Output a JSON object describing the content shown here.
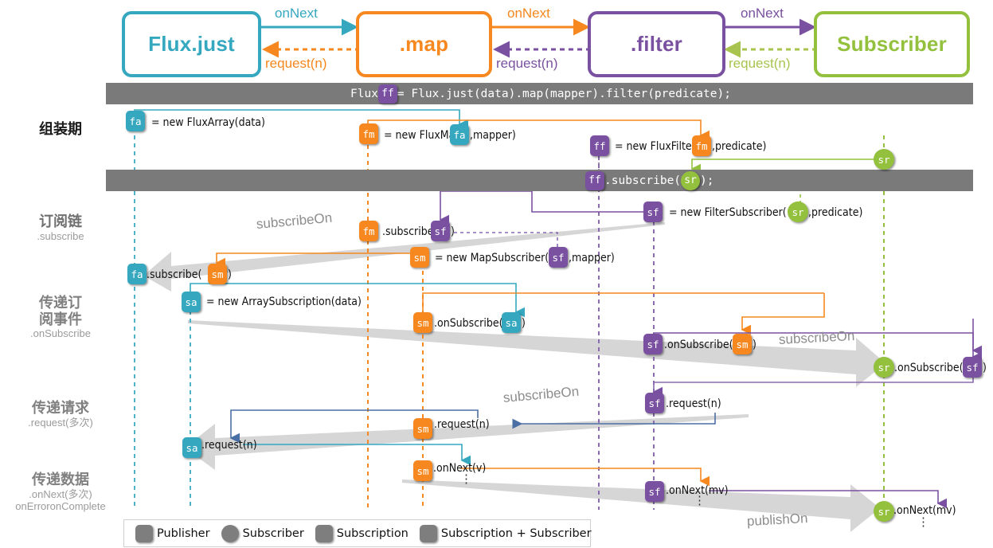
{
  "pipeline": {
    "boxes": [
      {
        "label": "Flux.just",
        "color": "#35a8c0"
      },
      {
        "label": ".map",
        "color": "#f6881f"
      },
      {
        "label": ".filter",
        "color": "#7a51a1"
      },
      {
        "label": "Subscriber",
        "color": "#93c13d"
      }
    ],
    "arrows": [
      {
        "forward": "onNext",
        "back": "request(n)",
        "forward_color": "#35a8c0",
        "back_color": "#f6881f"
      },
      {
        "forward": "onNext",
        "back": "request(n)",
        "forward_color": "#f6881f",
        "back_color": "#7a51a1"
      },
      {
        "forward": "onNext",
        "back": "request(n)",
        "forward_color": "#7a51a1",
        "back_color": "#a8c44e"
      }
    ]
  },
  "codebars": [
    {
      "pre": "Flux ",
      "token": "ff",
      "post": " = Flux.just(data).map(mapper).filter(predicate);"
    },
    {
      "pre": "",
      "token": "ff",
      "post": ".subscribe(",
      "token2": "sr",
      "post2": ");"
    }
  ],
  "rows": [
    {
      "cn": "组装期",
      "en": ""
    },
    {
      "cn": "订阅链",
      "en": ".subscribe"
    },
    {
      "cn": "传递订\n阅事件",
      "en": ".onSubscribe"
    },
    {
      "cn": "传递请求",
      "en": ".request(多次)"
    },
    {
      "cn": "传递数据",
      "en": ".onNext(多次)\nonError|onComplete"
    }
  ],
  "row_labels": {
    "assembly": "组装期",
    "subscribe_chain_cn": "订阅链",
    "subscribe_chain_en": ".subscribe",
    "onsubscribe_cn_1": "传递订",
    "onsubscribe_cn_2": "阅事件",
    "onsubscribe_en": ".onSubscribe",
    "request_cn": "传递请求",
    "request_en": ".request(多次)",
    "data_cn": "传递数据",
    "data_en_1": ".onNext(多次)",
    "data_en_2": "onErroronComplete"
  },
  "statements": {
    "fa_new": "= new FluxArray(data)",
    "fm_new_a": "= new FluxMap(",
    "fm_new_b": ",mapper)",
    "ff_new_a": "= new FluxFilter(",
    "ff_new_b": ",predicate)",
    "fm_subscribe_a": ".subscribe(",
    "fm_subscribe_b": ")",
    "sf_new_a": "= new FilterSubscriber(",
    "sf_new_b": ",predicate)",
    "sm_new_a": "= new MapSubscriber(",
    "sm_new_b": ",mapper)",
    "fa_subscribe_a": ".subscribe(",
    "fa_subscribe_b": ")",
    "sa_new": "= new ArraySubscription(data)",
    "sm_onsubscribe_a": ".onSubscribe(",
    "sm_onsubscribe_b": ")",
    "sf_onsubscribe_a": ".onSubscribe(",
    "sf_onsubscribe_b": ")",
    "sr_onsubscribe_a": ".onSubscribe(",
    "sr_onsubscribe_b": ")",
    "sf_request": ".request(n)",
    "sm_request": ".request(n)",
    "sa_request": ".request(n)",
    "sm_onnext": ".onNext(v)",
    "sf_onnext": ".onNext(mv)",
    "sr_onnext": ".onNext(mv)"
  },
  "tokens": {
    "fa": "fa",
    "fm": "fm",
    "ff": "ff",
    "sr": "sr",
    "sf": "sf",
    "sm": "sm",
    "sa": "sa"
  },
  "bands": [
    {
      "label": "subscribeOn"
    },
    {
      "label": "subscribeOn"
    },
    {
      "label": "subscribeOn"
    },
    {
      "label": "publishOn"
    }
  ],
  "band_labels": {
    "subscribe_chain": "subscribeOn",
    "onsubscribe": "subscribeOn",
    "request": "subscribeOn",
    "data": "publishOn"
  },
  "legend": {
    "items": [
      {
        "shape": "sq",
        "label": "Publisher"
      },
      {
        "shape": "cir",
        "label": "Subscriber"
      },
      {
        "shape": "sq",
        "label": "Subscription"
      },
      {
        "shape": "sq",
        "label": "Subscription + Subscriber"
      }
    ]
  },
  "colors": {
    "cyan": "#35a8c0",
    "orange": "#f6881f",
    "purple": "#7a51a1",
    "green": "#93c13d",
    "bar_grey": "#7a7a7a",
    "band_grey": "#d6d6d6"
  },
  "ellipsis": "⋮"
}
